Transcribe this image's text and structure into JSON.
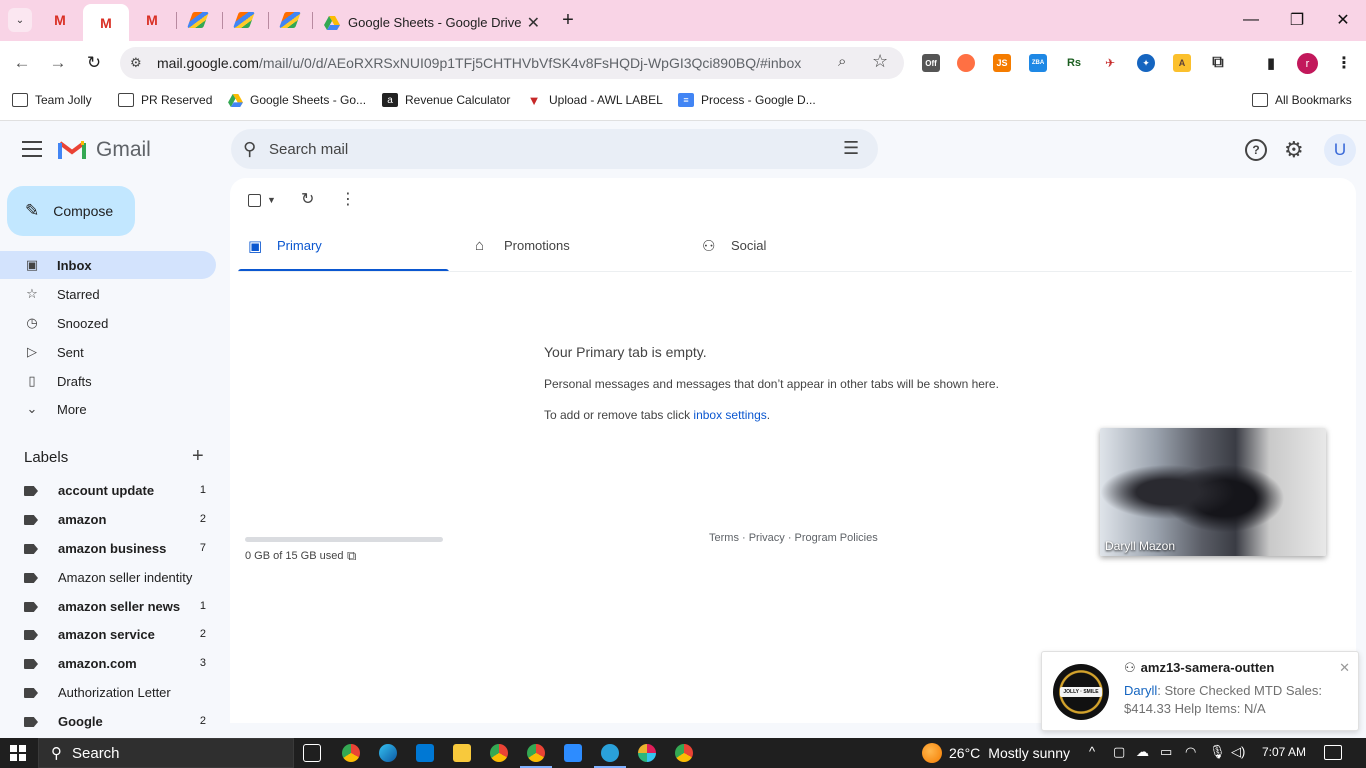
{
  "browser": {
    "active_tab_title": "Google Sheets - Google Drive",
    "url_host": "mail.google.com",
    "url_path": "/mail/u/0/d/AEoRXRSxNUI09p1TFj5CHTHVbVfSK4v8FsHQDj-WpGI3Qci890BQ/#inbox",
    "ext_off": "Off",
    "ext_js": "JS",
    "ext_zba": "ZBA",
    "ext_rs": "Rs",
    "profile_initial": "r"
  },
  "bookmarks": {
    "items": [
      "Team Jolly",
      "PR Reserved",
      "Google Sheets - Go...",
      "Revenue Calculator",
      "Upload - AWL LABEL",
      "Process - Google D..."
    ],
    "all": "All Bookmarks"
  },
  "gmail": {
    "app_name": "Gmail",
    "search_placeholder": "Search mail",
    "account_initial": "U",
    "compose": "Compose",
    "nav": [
      "Inbox",
      "Starred",
      "Snoozed",
      "Sent",
      "Drafts",
      "More"
    ],
    "labels_title": "Labels",
    "labels": [
      {
        "name": "account update",
        "count": "1"
      },
      {
        "name": "amazon",
        "count": "2"
      },
      {
        "name": "amazon business",
        "count": "7"
      },
      {
        "name": "Amazon seller indentity",
        "count": ""
      },
      {
        "name": "amazon seller news",
        "count": "1"
      },
      {
        "name": "amazon service",
        "count": "2"
      },
      {
        "name": "amazon.com",
        "count": "3"
      },
      {
        "name": "Authorization Letter",
        "count": ""
      },
      {
        "name": "Google",
        "count": "2"
      }
    ],
    "tabs": [
      "Primary",
      "Promotions",
      "Social"
    ],
    "empty_title": "Your Primary tab is empty.",
    "empty_desc": "Personal messages and messages that don’t appear in other tabs will be shown here.",
    "empty_hint_prefix": "To add or remove tabs click ",
    "empty_hint_link": "inbox settings",
    "empty_hint_suffix": ".",
    "storage_text": "0 GB of 15 GB used",
    "storage_fraction": 0.0,
    "footer": "Terms · Privacy · Program Policies"
  },
  "video": {
    "name": "Daryll Mazon"
  },
  "toast": {
    "badge": "JOLLY · SMILE",
    "group": "amz13-samera-outten",
    "sender": "Daryll",
    "message": ": Store Checked MTD Sales: $414.33 Help Items: N/A"
  },
  "taskbar": {
    "search": "Search",
    "temperature": "26°C",
    "weather": "Mostly sunny",
    "time": "7:07 AM"
  }
}
